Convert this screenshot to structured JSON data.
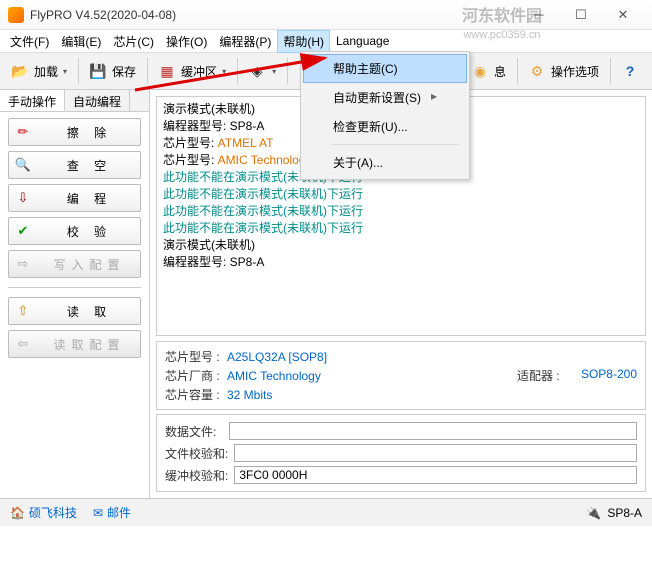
{
  "title": "FlyPRO V4.52(2020-04-08)",
  "watermark": {
    "line1": "河东软件园",
    "line2": "www.pc0359.cn"
  },
  "menubar": [
    {
      "key": "file",
      "label": "文件(F)"
    },
    {
      "key": "edit",
      "label": "编辑(E)"
    },
    {
      "key": "chip",
      "label": "芯片(C)"
    },
    {
      "key": "op",
      "label": "操作(O)"
    },
    {
      "key": "prog",
      "label": "编程器(P)"
    },
    {
      "key": "help",
      "label": "帮助(H)",
      "active": true
    },
    {
      "key": "lang",
      "label": "Language"
    }
  ],
  "helpmenu": [
    {
      "label": "帮助主题(C)",
      "hl": true
    },
    {
      "label": "自动更新设置(S)",
      "sub": true
    },
    {
      "label": "检查更新(U)..."
    },
    {
      "sep": true
    },
    {
      "label": "关于(A)..."
    }
  ],
  "toolbar": {
    "load": "加载",
    "save": "保存",
    "buffer": "缓冲区",
    "info": "息",
    "options": "操作选项"
  },
  "tabs": {
    "manual": "手动操作",
    "auto": "自动编程"
  },
  "opbuttons": [
    {
      "id": "erase",
      "label": "擦   除",
      "icon": "✏",
      "color": "#c00"
    },
    {
      "id": "blank",
      "label": "查   空",
      "icon": "🔍",
      "color": "#06c"
    },
    {
      "id": "program",
      "label": "编   程",
      "icon": "⇩",
      "color": "#900"
    },
    {
      "id": "verify",
      "label": "校   验",
      "icon": "✔",
      "color": "#090"
    },
    {
      "id": "writecfg",
      "label": "写入配置",
      "icon": "⇨",
      "color": "#aaa",
      "disabled": true
    },
    {
      "id": "read",
      "label": "读   取",
      "icon": "⇧",
      "color": "#c80",
      "sepBefore": true
    },
    {
      "id": "readcfg",
      "label": "读取配置",
      "icon": "⇦",
      "color": "#aaa",
      "disabled": true
    }
  ],
  "log": [
    {
      "t": "演示模式(未联机)",
      "c": "c-black"
    },
    {
      "t": "编程器型号: SP8-A",
      "c": "c-black"
    },
    {
      "t": " ",
      "c": "c-black"
    },
    {
      "t": "芯片型号: ATMEL   AT",
      "c": "c-black",
      "pre": "芯片型号: ",
      "v": "ATMEL   AT",
      "vc": "c-orange"
    },
    {
      "t": " ",
      "c": "c-black"
    },
    {
      "t": "芯片型号: AMIC Technology   A25LQ32A [SOP8]",
      "c": "c-black",
      "pre": "芯片型号: ",
      "v": "AMIC Technology   A25LQ32A [SOP8]",
      "vc": "c-orange"
    },
    {
      "t": "此功能不能在演示模式(未联机)下运行",
      "c": "c-teal"
    },
    {
      "t": "此功能不能在演示模式(未联机)下运行",
      "c": "c-teal"
    },
    {
      "t": "此功能不能在演示模式(未联机)下运行",
      "c": "c-teal"
    },
    {
      "t": "此功能不能在演示模式(未联机)下运行",
      "c": "c-teal"
    },
    {
      "t": "演示模式(未联机)",
      "c": "c-black"
    },
    {
      "t": "编程器型号: SP8-A",
      "c": "c-black"
    }
  ],
  "info": {
    "chipmodel_l": "芯片型号 :",
    "chipmodel_v": "A25LQ32A [SOP8]",
    "vendor_l": "芯片厂商 :",
    "vendor_v": "AMIC Technology",
    "capacity_l": "芯片容量 :",
    "capacity_v": "32 Mbits",
    "adapter_l": "适配器 :",
    "adapter_v": "SOP8-200"
  },
  "fileinfo": {
    "datafile_l": "数据文件:",
    "datafile_v": "",
    "filecrc_l": "文件校验和:",
    "filecrc_v": "",
    "bufcrc_l": "缓冲校验和:",
    "bufcrc_v": "3FC0 0000H"
  },
  "status": {
    "company": "硕飞科技",
    "email": "邮件",
    "device": "SP8-A"
  }
}
